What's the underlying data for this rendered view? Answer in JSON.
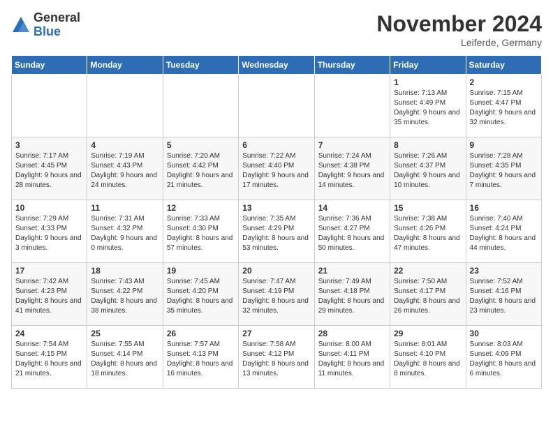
{
  "logo": {
    "general": "General",
    "blue": "Blue"
  },
  "title": "November 2024",
  "location": "Leiferde, Germany",
  "weekdays": [
    "Sunday",
    "Monday",
    "Tuesday",
    "Wednesday",
    "Thursday",
    "Friday",
    "Saturday"
  ],
  "weeks": [
    [
      {
        "day": "",
        "sunrise": "",
        "sunset": "",
        "daylight": ""
      },
      {
        "day": "",
        "sunrise": "",
        "sunset": "",
        "daylight": ""
      },
      {
        "day": "",
        "sunrise": "",
        "sunset": "",
        "daylight": ""
      },
      {
        "day": "",
        "sunrise": "",
        "sunset": "",
        "daylight": ""
      },
      {
        "day": "",
        "sunrise": "",
        "sunset": "",
        "daylight": ""
      },
      {
        "day": "1",
        "sunrise": "Sunrise: 7:13 AM",
        "sunset": "Sunset: 4:49 PM",
        "daylight": "Daylight: 9 hours and 35 minutes."
      },
      {
        "day": "2",
        "sunrise": "Sunrise: 7:15 AM",
        "sunset": "Sunset: 4:47 PM",
        "daylight": "Daylight: 9 hours and 32 minutes."
      }
    ],
    [
      {
        "day": "3",
        "sunrise": "Sunrise: 7:17 AM",
        "sunset": "Sunset: 4:45 PM",
        "daylight": "Daylight: 9 hours and 28 minutes."
      },
      {
        "day": "4",
        "sunrise": "Sunrise: 7:19 AM",
        "sunset": "Sunset: 4:43 PM",
        "daylight": "Daylight: 9 hours and 24 minutes."
      },
      {
        "day": "5",
        "sunrise": "Sunrise: 7:20 AM",
        "sunset": "Sunset: 4:42 PM",
        "daylight": "Daylight: 9 hours and 21 minutes."
      },
      {
        "day": "6",
        "sunrise": "Sunrise: 7:22 AM",
        "sunset": "Sunset: 4:40 PM",
        "daylight": "Daylight: 9 hours and 17 minutes."
      },
      {
        "day": "7",
        "sunrise": "Sunrise: 7:24 AM",
        "sunset": "Sunset: 4:38 PM",
        "daylight": "Daylight: 9 hours and 14 minutes."
      },
      {
        "day": "8",
        "sunrise": "Sunrise: 7:26 AM",
        "sunset": "Sunset: 4:37 PM",
        "daylight": "Daylight: 9 hours and 10 minutes."
      },
      {
        "day": "9",
        "sunrise": "Sunrise: 7:28 AM",
        "sunset": "Sunset: 4:35 PM",
        "daylight": "Daylight: 9 hours and 7 minutes."
      }
    ],
    [
      {
        "day": "10",
        "sunrise": "Sunrise: 7:29 AM",
        "sunset": "Sunset: 4:33 PM",
        "daylight": "Daylight: 9 hours and 3 minutes."
      },
      {
        "day": "11",
        "sunrise": "Sunrise: 7:31 AM",
        "sunset": "Sunset: 4:32 PM",
        "daylight": "Daylight: 9 hours and 0 minutes."
      },
      {
        "day": "12",
        "sunrise": "Sunrise: 7:33 AM",
        "sunset": "Sunset: 4:30 PM",
        "daylight": "Daylight: 8 hours and 57 minutes."
      },
      {
        "day": "13",
        "sunrise": "Sunrise: 7:35 AM",
        "sunset": "Sunset: 4:29 PM",
        "daylight": "Daylight: 8 hours and 53 minutes."
      },
      {
        "day": "14",
        "sunrise": "Sunrise: 7:36 AM",
        "sunset": "Sunset: 4:27 PM",
        "daylight": "Daylight: 8 hours and 50 minutes."
      },
      {
        "day": "15",
        "sunrise": "Sunrise: 7:38 AM",
        "sunset": "Sunset: 4:26 PM",
        "daylight": "Daylight: 8 hours and 47 minutes."
      },
      {
        "day": "16",
        "sunrise": "Sunrise: 7:40 AM",
        "sunset": "Sunset: 4:24 PM",
        "daylight": "Daylight: 8 hours and 44 minutes."
      }
    ],
    [
      {
        "day": "17",
        "sunrise": "Sunrise: 7:42 AM",
        "sunset": "Sunset: 4:23 PM",
        "daylight": "Daylight: 8 hours and 41 minutes."
      },
      {
        "day": "18",
        "sunrise": "Sunrise: 7:43 AM",
        "sunset": "Sunset: 4:22 PM",
        "daylight": "Daylight: 8 hours and 38 minutes."
      },
      {
        "day": "19",
        "sunrise": "Sunrise: 7:45 AM",
        "sunset": "Sunset: 4:20 PM",
        "daylight": "Daylight: 8 hours and 35 minutes."
      },
      {
        "day": "20",
        "sunrise": "Sunrise: 7:47 AM",
        "sunset": "Sunset: 4:19 PM",
        "daylight": "Daylight: 8 hours and 32 minutes."
      },
      {
        "day": "21",
        "sunrise": "Sunrise: 7:49 AM",
        "sunset": "Sunset: 4:18 PM",
        "daylight": "Daylight: 8 hours and 29 minutes."
      },
      {
        "day": "22",
        "sunrise": "Sunrise: 7:50 AM",
        "sunset": "Sunset: 4:17 PM",
        "daylight": "Daylight: 8 hours and 26 minutes."
      },
      {
        "day": "23",
        "sunrise": "Sunrise: 7:52 AM",
        "sunset": "Sunset: 4:16 PM",
        "daylight": "Daylight: 8 hours and 23 minutes."
      }
    ],
    [
      {
        "day": "24",
        "sunrise": "Sunrise: 7:54 AM",
        "sunset": "Sunset: 4:15 PM",
        "daylight": "Daylight: 8 hours and 21 minutes."
      },
      {
        "day": "25",
        "sunrise": "Sunrise: 7:55 AM",
        "sunset": "Sunset: 4:14 PM",
        "daylight": "Daylight: 8 hours and 18 minutes."
      },
      {
        "day": "26",
        "sunrise": "Sunrise: 7:57 AM",
        "sunset": "Sunset: 4:13 PM",
        "daylight": "Daylight: 8 hours and 16 minutes."
      },
      {
        "day": "27",
        "sunrise": "Sunrise: 7:58 AM",
        "sunset": "Sunset: 4:12 PM",
        "daylight": "Daylight: 8 hours and 13 minutes."
      },
      {
        "day": "28",
        "sunrise": "Sunrise: 8:00 AM",
        "sunset": "Sunset: 4:11 PM",
        "daylight": "Daylight: 8 hours and 11 minutes."
      },
      {
        "day": "29",
        "sunrise": "Sunrise: 8:01 AM",
        "sunset": "Sunset: 4:10 PM",
        "daylight": "Daylight: 8 hours and 8 minutes."
      },
      {
        "day": "30",
        "sunrise": "Sunrise: 8:03 AM",
        "sunset": "Sunset: 4:09 PM",
        "daylight": "Daylight: 8 hours and 6 minutes."
      }
    ]
  ]
}
